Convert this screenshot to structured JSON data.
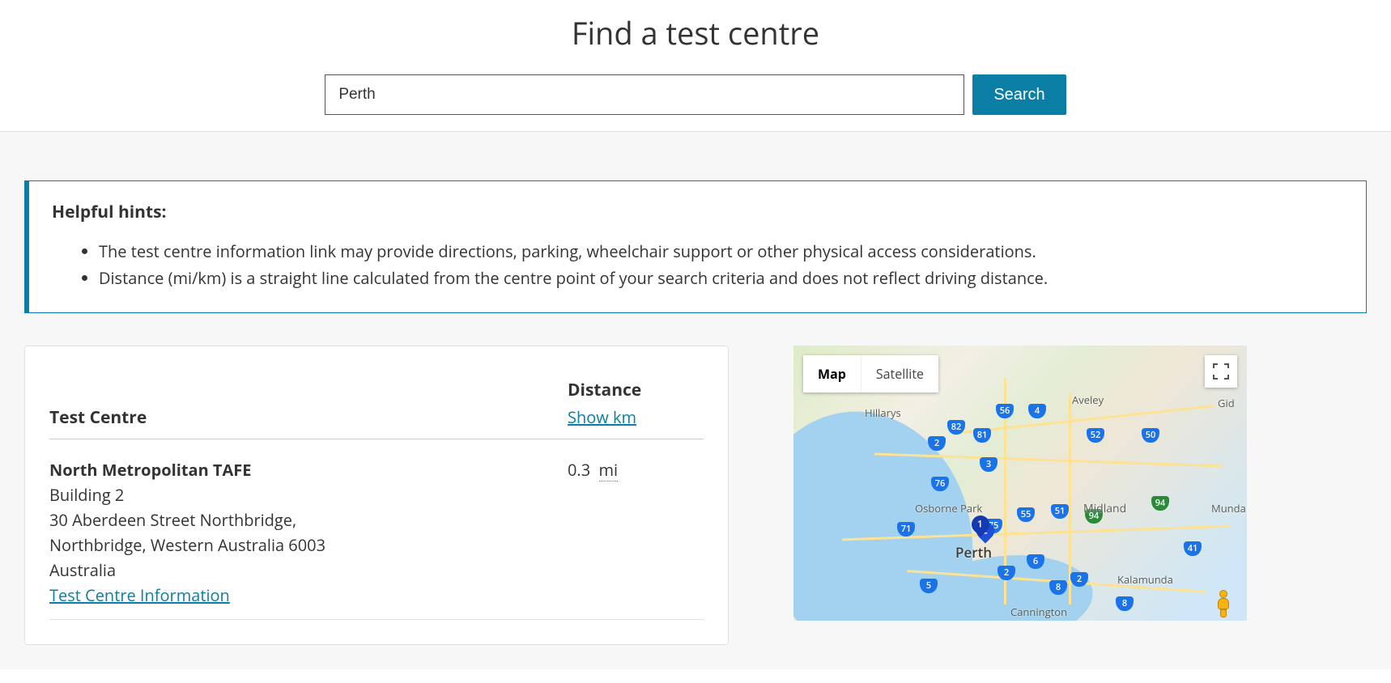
{
  "header": {
    "title": "Find a test centre",
    "search_value": "Perth",
    "search_button_label": "Search"
  },
  "hints": {
    "title": "Helpful hints:",
    "items": [
      "The test centre information link may provide directions, parking, wheelchair support or other physical access considerations.",
      "Distance (mi/km) is a straight line calculated from the centre point of your search criteria and does not reflect driving distance."
    ]
  },
  "results_table": {
    "columns": {
      "centre": "Test Centre",
      "distance": "Distance",
      "toggle_label": "Show km"
    },
    "rows": [
      {
        "name": "North Metropolitan TAFE",
        "address_lines": [
          "Building 2",
          "30 Aberdeen Street Northbridge,",
          "Northbridge, Western Australia 6003",
          "Australia"
        ],
        "link_label": "Test Centre Information",
        "distance_value": "0.3",
        "distance_unit": "mi"
      }
    ]
  },
  "map": {
    "tabs": {
      "map": "Map",
      "satellite": "Satellite"
    },
    "pins": [
      {
        "label": "1"
      },
      {
        "label": "2"
      }
    ],
    "labels": {
      "perth": "Perth",
      "hillarys": "Hillarys",
      "aveley": "Aveley",
      "midland": "Midland",
      "munda": "Munda",
      "osborne": "Osborne Park",
      "kalamunda": "Kalamunda",
      "cannington": "Cannington",
      "gid": "Gid"
    },
    "shields": {
      "s2a": "2",
      "s2b": "2",
      "s3": "3",
      "s4": "4",
      "s5": "5",
      "s6": "6",
      "s8": "8",
      "s41": "41",
      "s50": "50",
      "s51": "51",
      "s52": "52",
      "s55": "55",
      "s56": "56",
      "s71": "71",
      "s75": "75",
      "s76": "76",
      "s81": "81",
      "s82": "82",
      "s94": "94"
    }
  }
}
